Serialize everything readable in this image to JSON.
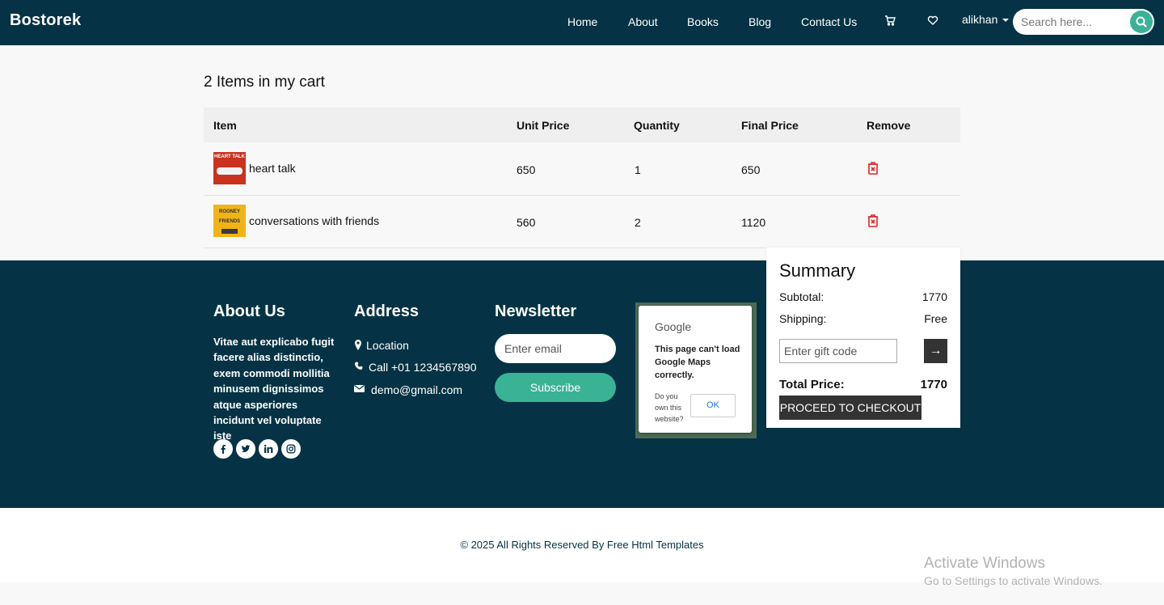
{
  "nav": {
    "brand": "Bostorek",
    "links": [
      "Home",
      "About",
      "Books",
      "Blog",
      "Contact Us"
    ],
    "user": "alikhan",
    "search_placeholder": "Search here..."
  },
  "cart": {
    "title": "2 Items in my cart",
    "headers": [
      "Item",
      "Unit Price",
      "Quantity",
      "Final Price",
      "Remove"
    ],
    "items": [
      {
        "name": "heart talk",
        "unit_price": "650",
        "quantity": "1",
        "final_price": "650",
        "cover_text": "HEART TALK",
        "cover_color": "#c8321e"
      },
      {
        "name": "conversations with friends",
        "unit_price": "560",
        "quantity": "2",
        "final_price": "1120",
        "cover_text": "ROONEY FRIENDS",
        "cover_color": "#f0b417"
      }
    ]
  },
  "summary": {
    "title": "Summary",
    "subtotal_label": "Subtotal:",
    "subtotal_value": "1770",
    "shipping_label": "Shipping:",
    "shipping_value": "Free",
    "gift_placeholder": "Enter gift code",
    "apply_symbol": "→",
    "total_label": "Total Price:",
    "total_value": "1770",
    "checkout_label": "PROCEED TO CHECKOUT"
  },
  "footer": {
    "about_heading": "About Us",
    "about_text": "Vitae aut explicabo fugit facere alias distinctio, exem commodi mollitia minusem dignissimos atque asperiores incidunt vel voluptate iste",
    "socials": [
      "facebook-icon",
      "twitter-icon",
      "linkedin-icon",
      "instagram-icon"
    ],
    "address_heading": "Address",
    "address_items": [
      "Location",
      "Call +01 1234567890",
      "demo@gmail.com"
    ],
    "newsletter_heading": "Newsletter",
    "email_placeholder": "Enter email",
    "subscribe_label": "Subscribe",
    "map": {
      "logo": "Google",
      "message": "This page can't load Google Maps correctly.",
      "question": "Do you own this website?",
      "ok_label": "OK"
    }
  },
  "copyright": "© 2025 All Rights Reserved By Free Html Templates",
  "watermark": {
    "line1": "Activate Windows",
    "line2": "Go to Settings to activate Windows."
  },
  "colors": {
    "navy": "#053345",
    "accent": "#3ab295",
    "danger": "#e02424",
    "dark_button": "#333333"
  }
}
